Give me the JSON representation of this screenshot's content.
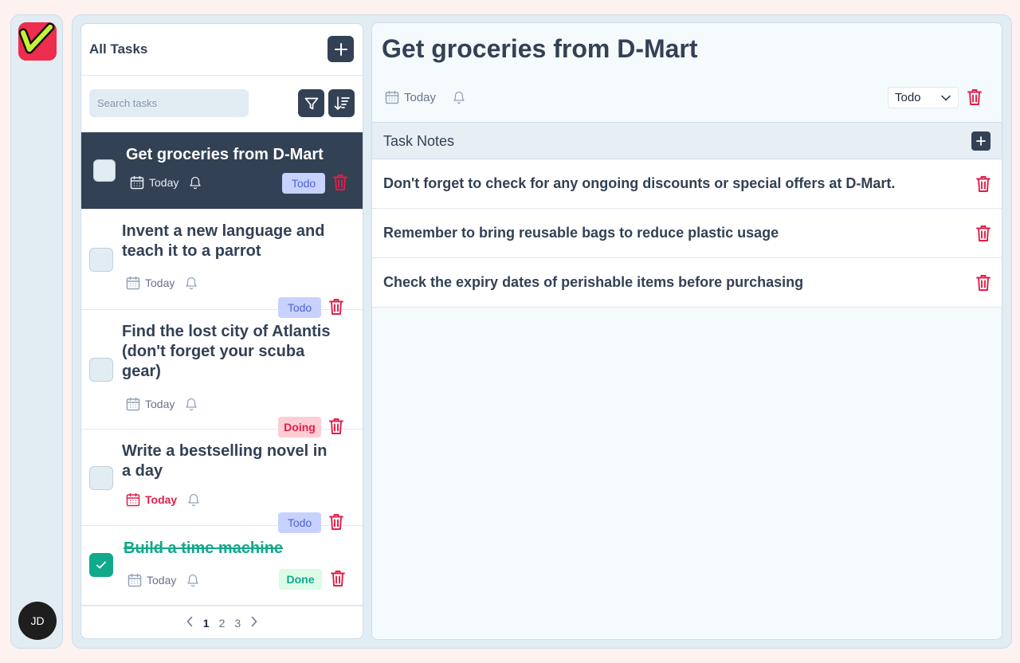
{
  "app": {
    "logo_icon": "check-logo-icon",
    "user_initials": "JD"
  },
  "list": {
    "title": "All Tasks",
    "add_icon": "plus-icon",
    "search_placeholder": "Search tasks",
    "filter_icon": "filter-icon",
    "sort_icon": "sort-icon",
    "tasks": [
      {
        "title": "Get groceries from D-Mart",
        "due": "Today",
        "status": "Todo",
        "completed": false,
        "overdue": false,
        "selected": true
      },
      {
        "title": "Invent a new language and teach it to a parrot",
        "due": "Today",
        "status": "Todo",
        "completed": false,
        "overdue": false
      },
      {
        "title": "Find the lost city of Atlantis (don't forget your scuba gear)",
        "due": "Today",
        "status": "Doing",
        "completed": false,
        "overdue": false
      },
      {
        "title": "Write a bestselling novel in a day",
        "due": "Today",
        "status": "Todo",
        "completed": false,
        "overdue": true
      },
      {
        "title": "Build a time machine",
        "due": "Today",
        "status": "Done",
        "completed": true,
        "overdue": false
      }
    ],
    "pagination": {
      "prev_icon": "chevron-left-icon",
      "pages": [
        "1",
        "2",
        "3"
      ],
      "current": "1",
      "next_icon": "chevron-right-icon"
    }
  },
  "detail": {
    "title": "Get groceries from D-Mart",
    "due": "Today",
    "status_value": "Todo",
    "notes_title": "Task Notes",
    "notes": [
      "Don't forget to check for any ongoing discounts or special offers at D-Mart.",
      "Remember to bring reusable bags to reduce plastic usage",
      "Check the expiry dates of perishable items before purchasing"
    ]
  },
  "colors": {
    "primary": "#334155",
    "danger": "#e11d48",
    "success": "#10a98b",
    "todo_badge": "#c7d2fe",
    "background": "#fdf2f0",
    "panel": "#e2ecf3"
  }
}
